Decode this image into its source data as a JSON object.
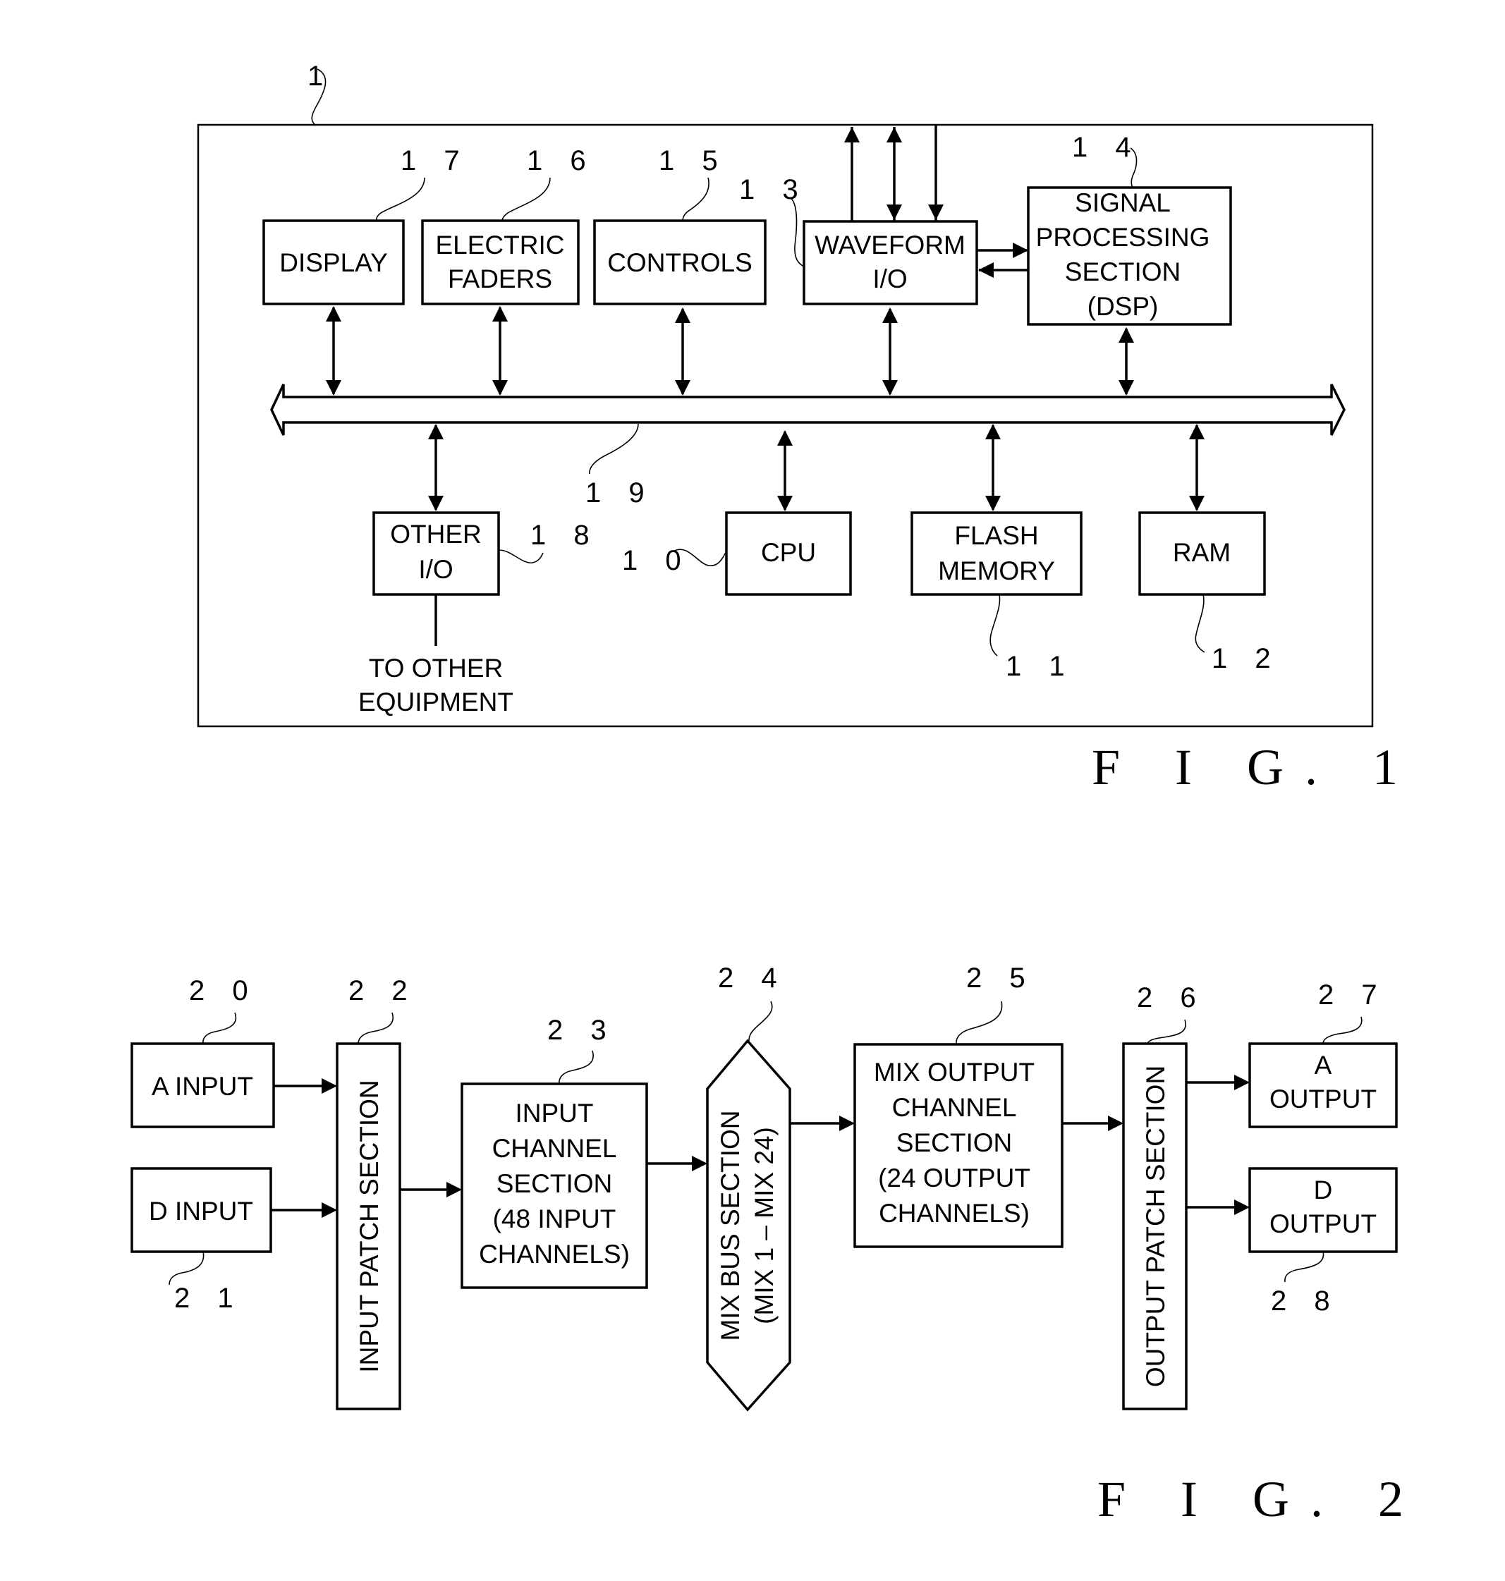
{
  "fig1": {
    "caption": "F I G. 1",
    "device_ref": "1",
    "blocks": {
      "display": {
        "ref": "1 7",
        "lines": [
          "DISPLAY"
        ]
      },
      "faders": {
        "ref": "1 6",
        "lines": [
          "ELECTRIC",
          "FADERS"
        ]
      },
      "controls": {
        "ref": "1 5",
        "lines": [
          "CONTROLS"
        ]
      },
      "waveform": {
        "ref": "1 3",
        "lines": [
          "WAVEFORM",
          "I/O"
        ]
      },
      "dsp": {
        "ref": "1 4",
        "lines": [
          "SIGNAL",
          "PROCESSING",
          "SECTION",
          "(DSP)"
        ]
      },
      "other_io": {
        "ref": "1 8",
        "lines": [
          "OTHER",
          "I/O"
        ]
      },
      "cpu": {
        "ref": "1 0",
        "lines": [
          "CPU"
        ]
      },
      "flash": {
        "ref": "1 1",
        "lines": [
          "FLASH",
          "MEMORY"
        ]
      },
      "ram": {
        "ref": "1 2",
        "lines": [
          "RAM"
        ]
      }
    },
    "bus_ref": "1 9",
    "external_label": [
      "TO OTHER",
      "EQUIPMENT"
    ]
  },
  "fig2": {
    "caption": "F I G. 2",
    "blocks": {
      "a_input": {
        "ref": "2 0",
        "lines": [
          "A INPUT"
        ]
      },
      "d_input": {
        "ref": "2 1",
        "lines": [
          "D INPUT"
        ]
      },
      "input_patch": {
        "ref": "2 2",
        "lines": [
          "INPUT PATCH SECTION"
        ]
      },
      "input_channel": {
        "ref": "2 3",
        "lines": [
          "INPUT",
          "CHANNEL",
          "SECTION",
          "(48 INPUT",
          "CHANNELS)"
        ]
      },
      "mix_bus": {
        "ref": "2 4",
        "lines": [
          "MIX BUS SECTION",
          "(MIX 1 – MIX 24)"
        ]
      },
      "mix_output": {
        "ref": "2 5",
        "lines": [
          "MIX OUTPUT",
          "CHANNEL",
          "SECTION",
          "(24 OUTPUT",
          "CHANNELS)"
        ]
      },
      "output_patch": {
        "ref": "2 6",
        "lines": [
          "OUTPUT PATCH SECTION"
        ]
      },
      "a_output": {
        "ref": "2 7",
        "lines": [
          "A",
          "OUTPUT"
        ]
      },
      "d_output": {
        "ref": "2 8",
        "lines": [
          "D",
          "OUTPUT"
        ]
      }
    }
  }
}
